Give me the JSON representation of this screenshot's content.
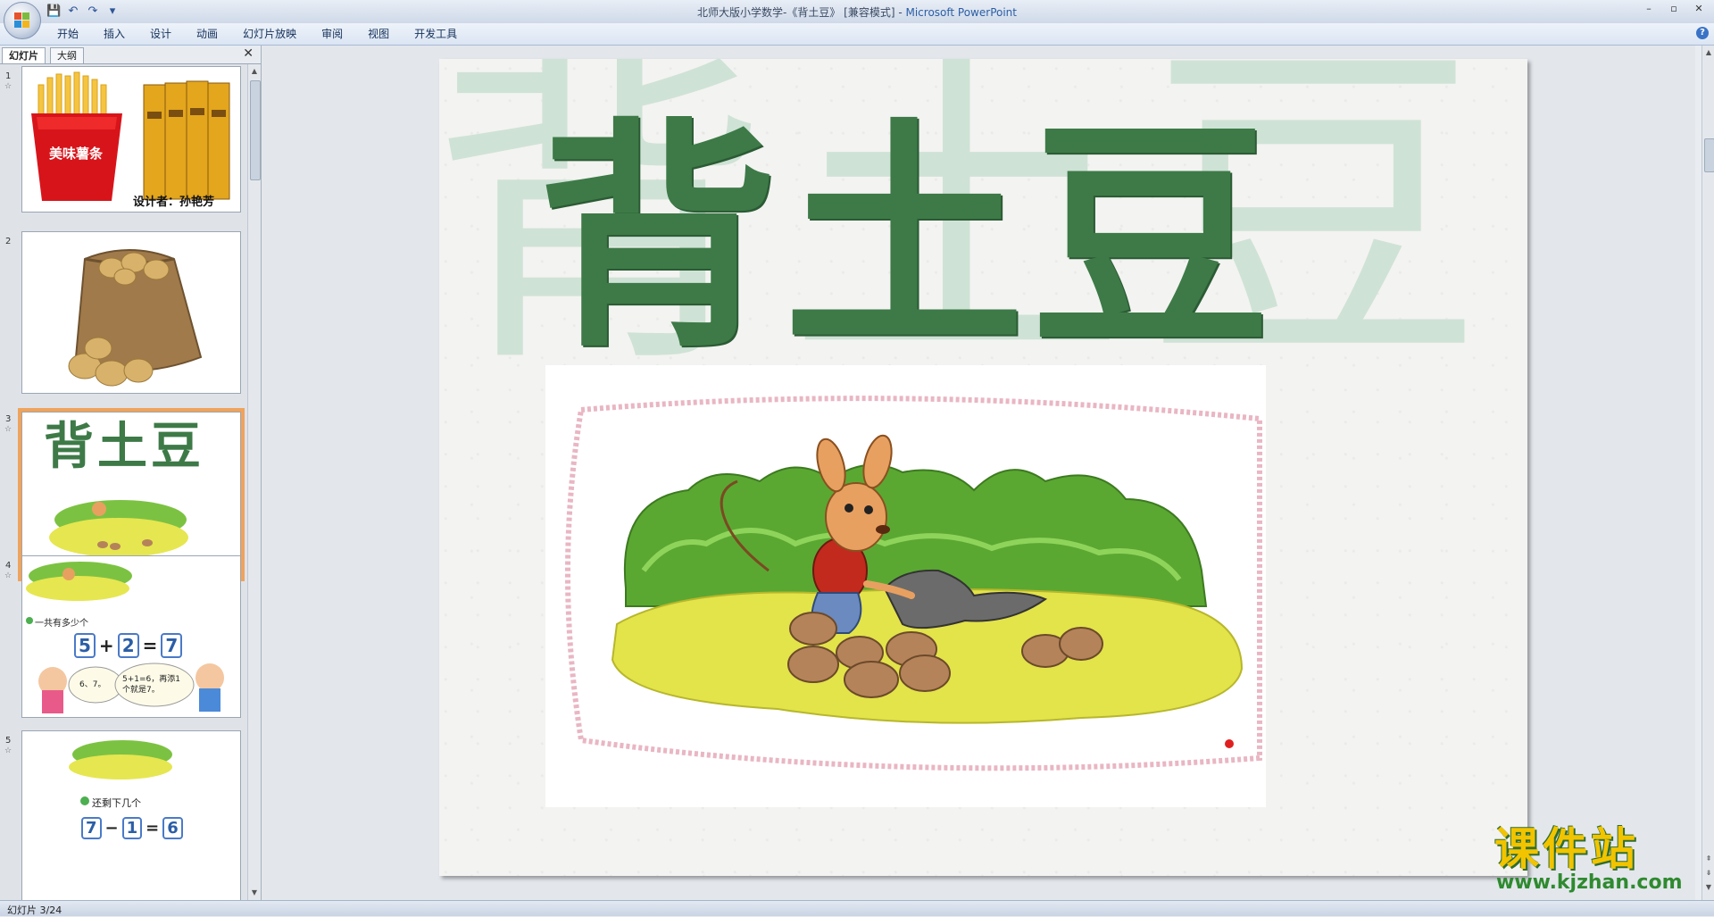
{
  "window": {
    "title_doc": "北师大版小学数学-《背土豆》 [兼容模式] - ",
    "title_app": "Microsoft PowerPoint",
    "minimize": "–",
    "restore": "▫",
    "close": "✕"
  },
  "qat": {
    "save": "💾",
    "undo": "↶",
    "redo": "↷",
    "more": "▾"
  },
  "ribbon": {
    "tabs": [
      "开始",
      "插入",
      "设计",
      "动画",
      "幻灯片放映",
      "审阅",
      "视图",
      "开发工具"
    ],
    "help": "?"
  },
  "panel": {
    "tabs": {
      "slides": "幻灯片",
      "outline": "大纲"
    },
    "close": "✕",
    "thumbnails": [
      {
        "num": "1",
        "star": "☆",
        "brand": "美味薯条",
        "caption": "设计者：孙艳芳"
      },
      {
        "num": "2",
        "star": "",
        "caption": ""
      },
      {
        "num": "3",
        "star": "☆",
        "caption": "背土豆"
      },
      {
        "num": "4",
        "star": "☆",
        "question": "一共有多少个",
        "eq": [
          "5",
          "+",
          "2",
          "=",
          "7"
        ],
        "bubble1": "6、7。",
        "bubble2": "5+1=6，再添1个就是7。"
      },
      {
        "num": "5",
        "star": "☆",
        "question": "还剩下几个",
        "eq": [
          "7",
          "−",
          "1",
          "=",
          "6"
        ]
      }
    ]
  },
  "slide": {
    "title": "背土豆",
    "ghost_title": "背土豆"
  },
  "status": {
    "text": "幻灯片 3/24"
  },
  "watermark": {
    "main": "课件站",
    "url": "www.kjzhan.com"
  },
  "colors": {
    "title_green": "#3d7a47",
    "selection": "#f0a35a",
    "watermark_yellow": "#f2c400"
  }
}
